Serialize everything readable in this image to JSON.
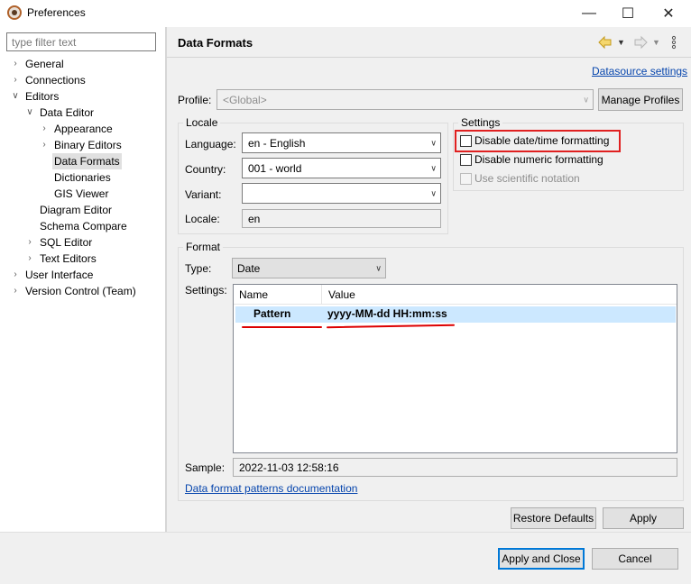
{
  "window": {
    "title": "Preferences",
    "minimize": "—",
    "maximize": "☐",
    "close": "✕"
  },
  "filter": {
    "placeholder": "type filter text"
  },
  "tree": {
    "general": "General",
    "connections": "Connections",
    "editors": "Editors",
    "data_editor": "Data Editor",
    "appearance": "Appearance",
    "binary_editors": "Binary Editors",
    "data_formats": "Data Formats",
    "dictionaries": "Dictionaries",
    "gis_viewer": "GIS Viewer",
    "diagram_editor": "Diagram Editor",
    "schema_compare": "Schema Compare",
    "sql_editor": "SQL Editor",
    "text_editors": "Text Editors",
    "user_interface": "User Interface",
    "version_control": "Version Control (Team)"
  },
  "page": {
    "title": "Data Formats",
    "datasource_link": "Datasource settings",
    "profile_label": "Profile:",
    "profile_value": "<Global>",
    "manage_profiles": "Manage Profiles"
  },
  "locale": {
    "group_title": "Locale",
    "language_label": "Language:",
    "language_value": "en - English",
    "country_label": "Country:",
    "country_value": "001 - world",
    "variant_label": "Variant:",
    "variant_value": "",
    "locale_label": "Locale:",
    "locale_value": "en"
  },
  "settings": {
    "group_title": "Settings",
    "disable_datetime": "Disable date/time formatting",
    "disable_numeric": "Disable numeric formatting",
    "scientific": "Use scientific notation"
  },
  "format": {
    "group_title": "Format",
    "type_label": "Type:",
    "type_value": "Date",
    "settings_label": "Settings:",
    "col_name": "Name",
    "col_value": "Value",
    "row_name": "Pattern",
    "row_value": "yyyy-MM-dd HH:mm:ss",
    "sample_label": "Sample:",
    "sample_value": "2022-11-03 12:58:16",
    "doc_link": "Data format patterns documentation"
  },
  "buttons": {
    "restore_defaults": "Restore Defaults",
    "apply": "Apply",
    "apply_close": "Apply and Close",
    "cancel": "Cancel"
  },
  "colors": {
    "highlight_red": "#e02020",
    "selection": "#cce8ff",
    "link": "#0645ad",
    "accent": "#0078d7"
  }
}
